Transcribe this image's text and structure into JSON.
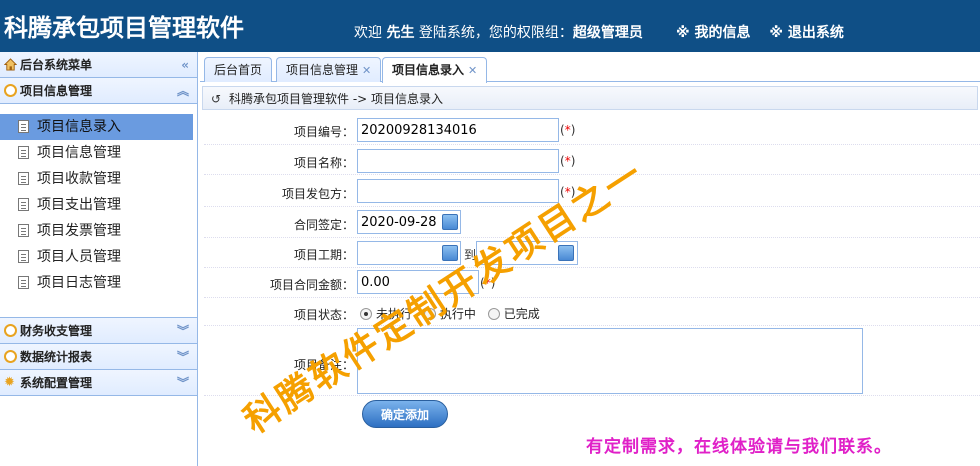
{
  "header": {
    "app_title": "科腾承包项目管理软件",
    "welcome_prefix": "欢迎",
    "user_name": "先生",
    "welcome_middle": "登陆系统，您的权限组：",
    "role": "超级管理员",
    "my_info": "※ 我的信息",
    "logout": "※ 退出系统"
  },
  "sidebar": {
    "title": "后台系统菜单",
    "sections": [
      {
        "label": "项目信息管理",
        "icon": "clock-icon",
        "expanded": true
      },
      {
        "label": "财务收支管理",
        "icon": "clock-icon",
        "expanded": false
      },
      {
        "label": "数据统计报表",
        "icon": "clock-icon",
        "expanded": false
      },
      {
        "label": "系统配置管理",
        "icon": "gear-icon",
        "expanded": false
      }
    ],
    "items": [
      {
        "label": "项目信息录入",
        "active": true
      },
      {
        "label": "项目信息管理"
      },
      {
        "label": "项目收款管理"
      },
      {
        "label": "项目支出管理"
      },
      {
        "label": "项目发票管理"
      },
      {
        "label": "项目人员管理"
      },
      {
        "label": "项目日志管理"
      }
    ]
  },
  "tabs": [
    {
      "label": "后台首页",
      "closable": false
    },
    {
      "label": "项目信息管理",
      "closable": true
    },
    {
      "label": "项目信息录入",
      "closable": true,
      "active": true
    }
  ],
  "breadcrumb": "科腾承包项目管理软件 -> 项目信息录入",
  "form": {
    "project_no_label": "项目编号：",
    "project_no_value": "20200928134016",
    "project_name_label": "项目名称：",
    "project_name_value": "",
    "contractor_label": "项目发包方：",
    "contractor_value": "",
    "sign_date_label": "合同签定：",
    "sign_date_value": "2020-09-28",
    "period_label": "项目工期：",
    "period_start": "",
    "period_to": "到",
    "period_end": "",
    "amount_label": "项目合同金额：",
    "amount_value": "0.00",
    "status_label": "项目状态：",
    "status_options": [
      "未执行",
      "执行中",
      "已完成"
    ],
    "status_selected": "未执行",
    "remark_label": "项目备注：",
    "remark_value": "",
    "required_mark": "*",
    "submit_label": "确定添加"
  },
  "footer_note": "有定制需求，在线体验请与我们联系。",
  "watermark": "科腾软件定制开发项目之一",
  "colors": {
    "header_bg": "#0f4f86",
    "active_menu": "#6a9be0",
    "border": "#95b8e7",
    "required": "#ee0000",
    "footer_note": "#e020c8",
    "watermark": "#f5a000"
  }
}
